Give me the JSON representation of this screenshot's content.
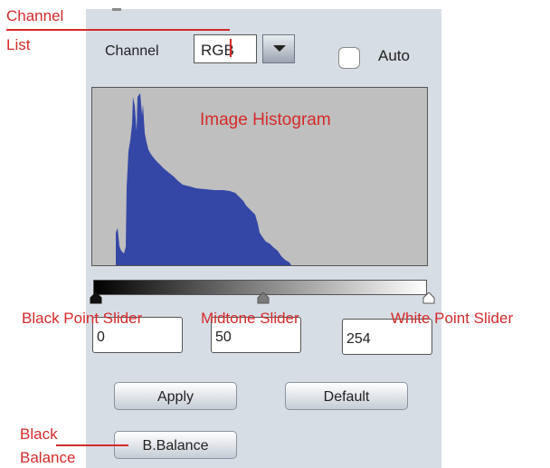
{
  "controls": {
    "channel_label": "Channel",
    "channel_value": "RGB",
    "auto_label": "Auto",
    "black_point_value": "0",
    "midtone_value": "50",
    "white_point_value": "254",
    "apply_label": "Apply",
    "default_label": "Default",
    "bbalance_label": "B.Balance"
  },
  "annotations": {
    "channel_list_1": "Channel",
    "channel_list_2": "List",
    "image_histogram": "Image Histogram",
    "black_point_slider": "Black Point Slider",
    "midtone_slider": "Midtone Slider",
    "white_point_slider": "White Point Slider",
    "black_balance_1": "Black",
    "black_balance_2": "Balance"
  },
  "colors": {
    "annotation": "#d52a2a",
    "histogram_fill": "#3447a6",
    "histogram_background": "#bfbfbf",
    "panel_background": "#d7dde5"
  }
}
